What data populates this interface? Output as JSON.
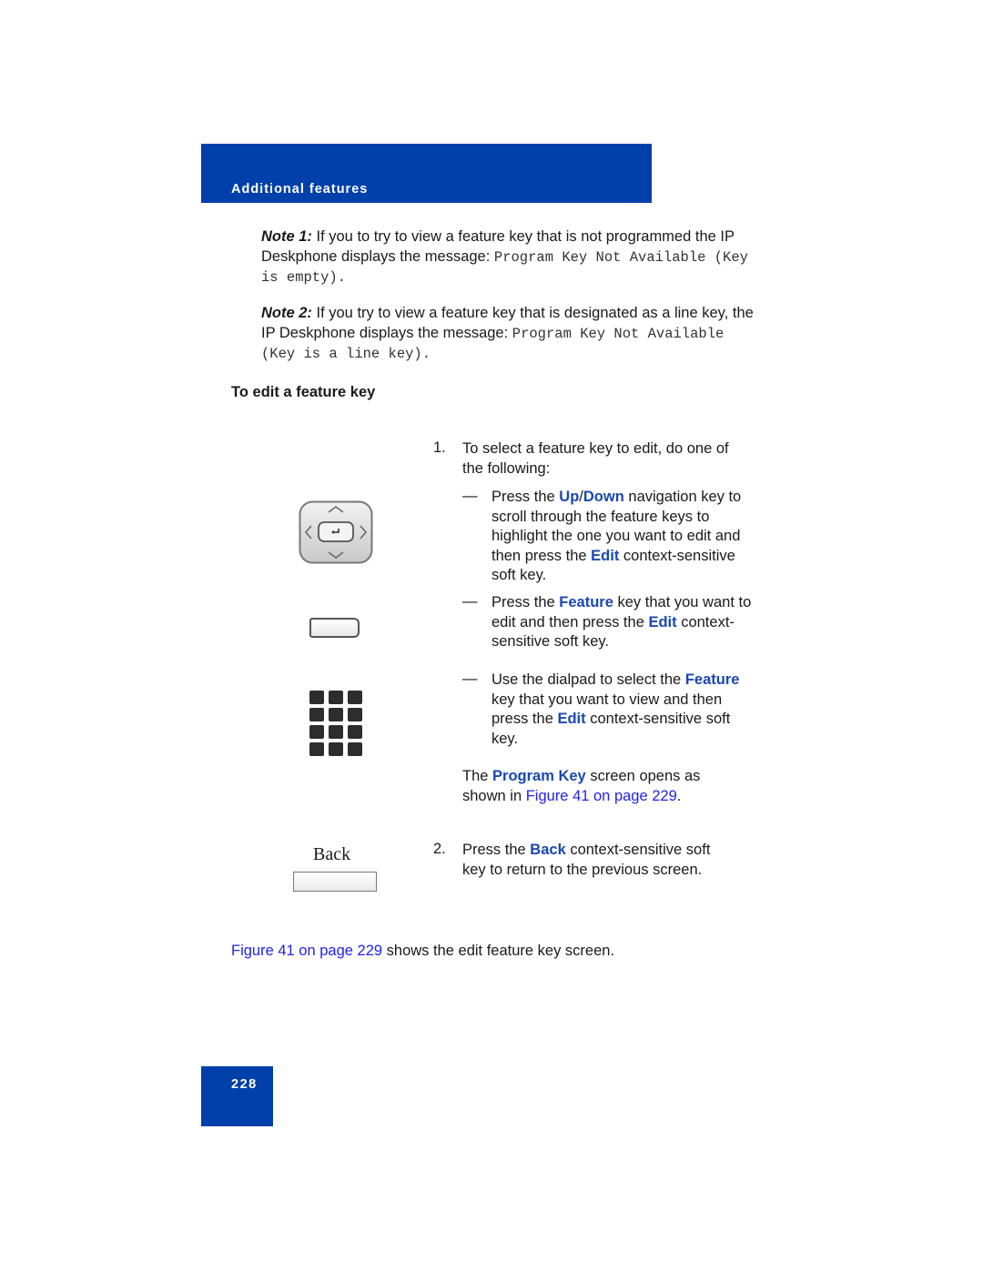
{
  "header": {
    "section_title": "Additional features"
  },
  "notes": [
    {
      "label": "Note 1:",
      "text": " If you to try to view a feature key that is not programmed the IP Deskphone displays the message: ",
      "message": "Program Key Not Available (Key is empty)."
    },
    {
      "label": "Note 2:",
      "text": " If you try to view a feature key that is designated as a line key, the IP Deskphone displays the message: ",
      "message": "Program Key Not Available (Key is a line key)."
    }
  ],
  "procedure": {
    "heading": "To edit a feature key",
    "step1": {
      "number": "1.",
      "text": "To select a feature key to edit, do one of the following:",
      "options": [
        {
          "dash": "—",
          "t1": "Press the ",
          "k1": "Up",
          "t2": "/",
          "k2": "Down",
          "t3": " navigation key to scroll through the feature keys to highlight the one you want to edit and then press the ",
          "k3": "Edit",
          "t4": " context-sensitive soft key."
        },
        {
          "dash": "—",
          "t1": "Press the ",
          "k1": "Feature",
          "t2": " key that you want to edit and then press the ",
          "k2": "Edit",
          "t3": " context-sensitive soft key."
        },
        {
          "dash": "—",
          "t1": "Use the dialpad to select the ",
          "k1": "Feature",
          "t2": " key that you want to view and then press the ",
          "k2": "Edit",
          "t3": " context-sensitive soft key."
        }
      ],
      "result": {
        "t1": "The ",
        "k1": "Program Key",
        "t2": " screen opens as shown in ",
        "link": "Figure 41 on page 229",
        "t3": "."
      }
    },
    "step2": {
      "number": "2.",
      "t1": "Press the ",
      "k1": "Back",
      "t2": " context-sensitive soft key to return to the previous screen."
    },
    "icons": {
      "back_key_label": "Back"
    }
  },
  "footer_para": {
    "link": "Figure 41 on page 229",
    "text": " shows the edit feature key screen."
  },
  "page_number": "228",
  "colors": {
    "brand_blue": "#0040aa",
    "keyword_blue": "#1a48b0",
    "link_blue": "#2222ee"
  }
}
